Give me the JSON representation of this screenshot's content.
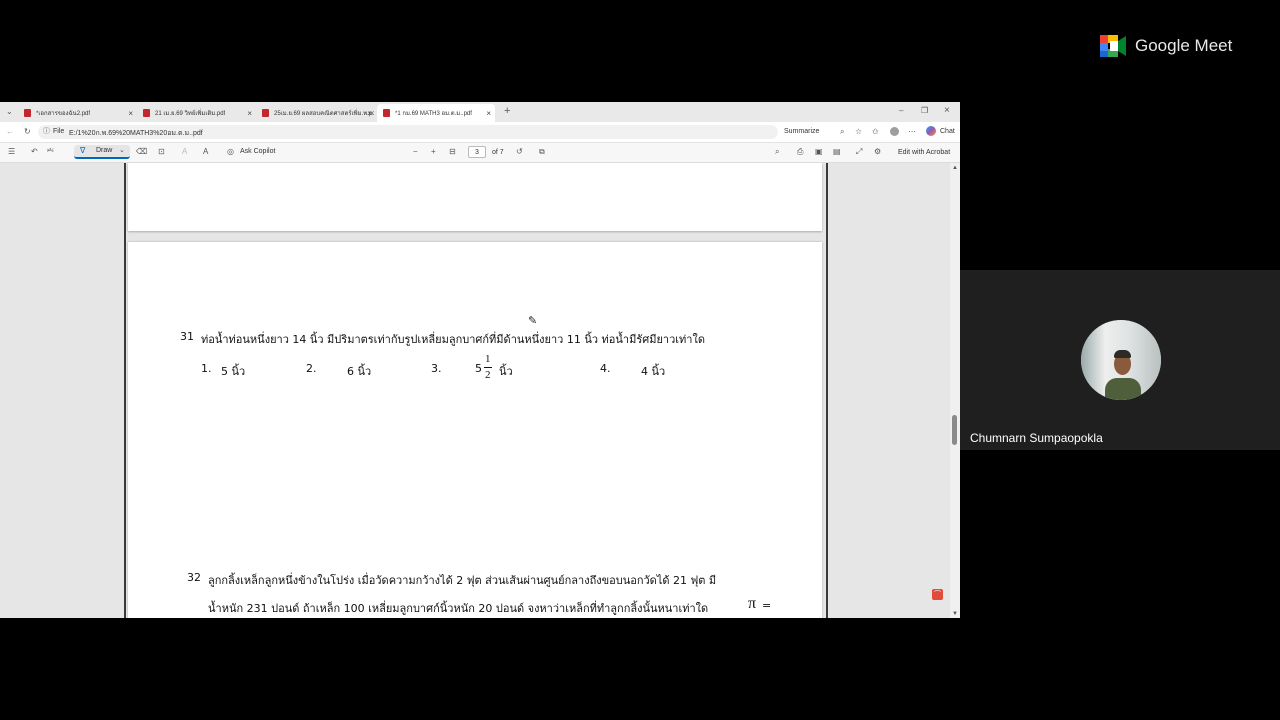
{
  "meet": {
    "brand": "Google Meet",
    "participant_name": "Chumnarn Sumpaopokla",
    "colors": {
      "blue": "#4285f4",
      "green": "#34a853",
      "yellow": "#fbbc04",
      "red": "#ea4335"
    }
  },
  "browser": {
    "tabs": [
      {
        "label": "*เอกสารของฉัน2.pdf",
        "active": false
      },
      {
        "label": "21 เม.ย.69 วิทย์เพิ่มเติม.pdf",
        "active": false
      },
      {
        "label": "25เม.ย.69 ผลสอบคณิตศาสตร์เพิ่ม.พ.pdf",
        "active": false
      },
      {
        "label": "*1 กม.69 MATH3 อม.ต.ม..pdf",
        "active": true
      }
    ],
    "address": {
      "scheme_label": "File",
      "url": "E:/1%20ก.พ.69%20MATH3%20อม.ต.ม..pdf",
      "summarize_label": "Summarize",
      "chat_label": "Chat"
    },
    "pdf_toolbar": {
      "draw_label": "Draw",
      "copilot_label": "Ask Copilot",
      "page_current": "3",
      "page_total": "of 7",
      "edit_label": "Edit with Acrobat"
    }
  },
  "document": {
    "q31": {
      "number": "31",
      "text": "ท่อน้ำท่อนหนึ่งยาว 14 นิ้ว มีปริมาตรเท่ากับรูปเหลี่ยมลูกบาศก์ที่มีด้านหนึ่งยาว 11 นิ้ว ท่อน้ำมีรัศมียาวเท่าใด",
      "choices": [
        {
          "num": "1.",
          "text": "5 นิ้ว"
        },
        {
          "num": "2.",
          "text": "6 นิ้ว"
        },
        {
          "num": "3.",
          "whole": "5",
          "numerator": "1",
          "denominator": "2",
          "unit": "นิ้ว"
        },
        {
          "num": "4.",
          "text": "4 นิ้ว"
        }
      ]
    },
    "q32": {
      "number": "32",
      "line1": "ลูกกลิ้งเหล็กลูกหนึ่งข้างในโปร่ง เมื่อวัดความกว้างได้ 2 ฟุต ส่วนเส้นผ่านศูนย์กลางถึงขอบนอกวัดได้ 21 ฟุต มี",
      "line2": "น้ำหนัก 231 ปอนด์ ถ้าเหล็ก 100 เหลี่ยมลูกบาศก์นิ้วหนัก 20 ปอนด์ จงหาว่าเหล็กที่ทำลูกกลิ้งนั้นหนาเท่าใด",
      "pi_symbol": "π",
      "equals": "="
    }
  }
}
